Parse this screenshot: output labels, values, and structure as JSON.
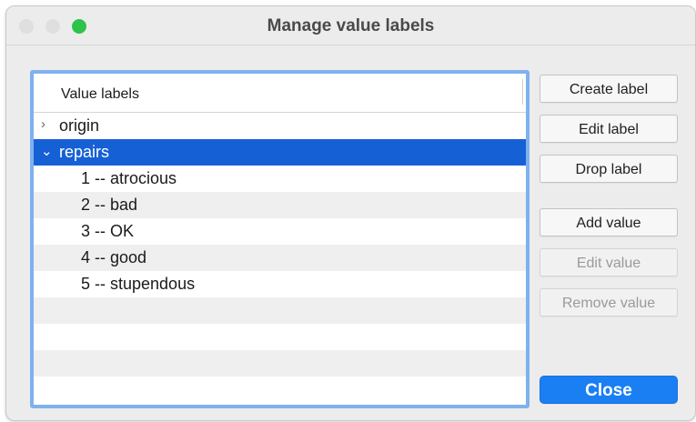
{
  "window": {
    "title": "Manage value labels",
    "traffic_colors": {
      "close": "#dfdfdf",
      "minimize": "#dfdfdf",
      "zoom": "#2dc34a"
    }
  },
  "list": {
    "header": "Value labels",
    "rows": [
      {
        "type": "group",
        "expanded": false,
        "chevron": "›",
        "label": "origin"
      },
      {
        "type": "group",
        "expanded": true,
        "selected": true,
        "chevron": "⌄",
        "label": "repairs"
      },
      {
        "type": "value",
        "label": "1 -- atrocious"
      },
      {
        "type": "value",
        "label": "2 -- bad"
      },
      {
        "type": "value",
        "label": "3 -- OK"
      },
      {
        "type": "value",
        "label": "4 -- good"
      },
      {
        "type": "value",
        "label": "5 -- stupendous"
      }
    ]
  },
  "buttons": {
    "create_label": "Create label",
    "edit_label": "Edit label",
    "drop_label": "Drop label",
    "add_value": "Add value",
    "edit_value": "Edit value",
    "remove_value": "Remove value",
    "close": "Close"
  },
  "colors": {
    "selection": "#1660d6",
    "focus_ring": "#7fb1ee",
    "primary_button": "#1a7ff3"
  }
}
